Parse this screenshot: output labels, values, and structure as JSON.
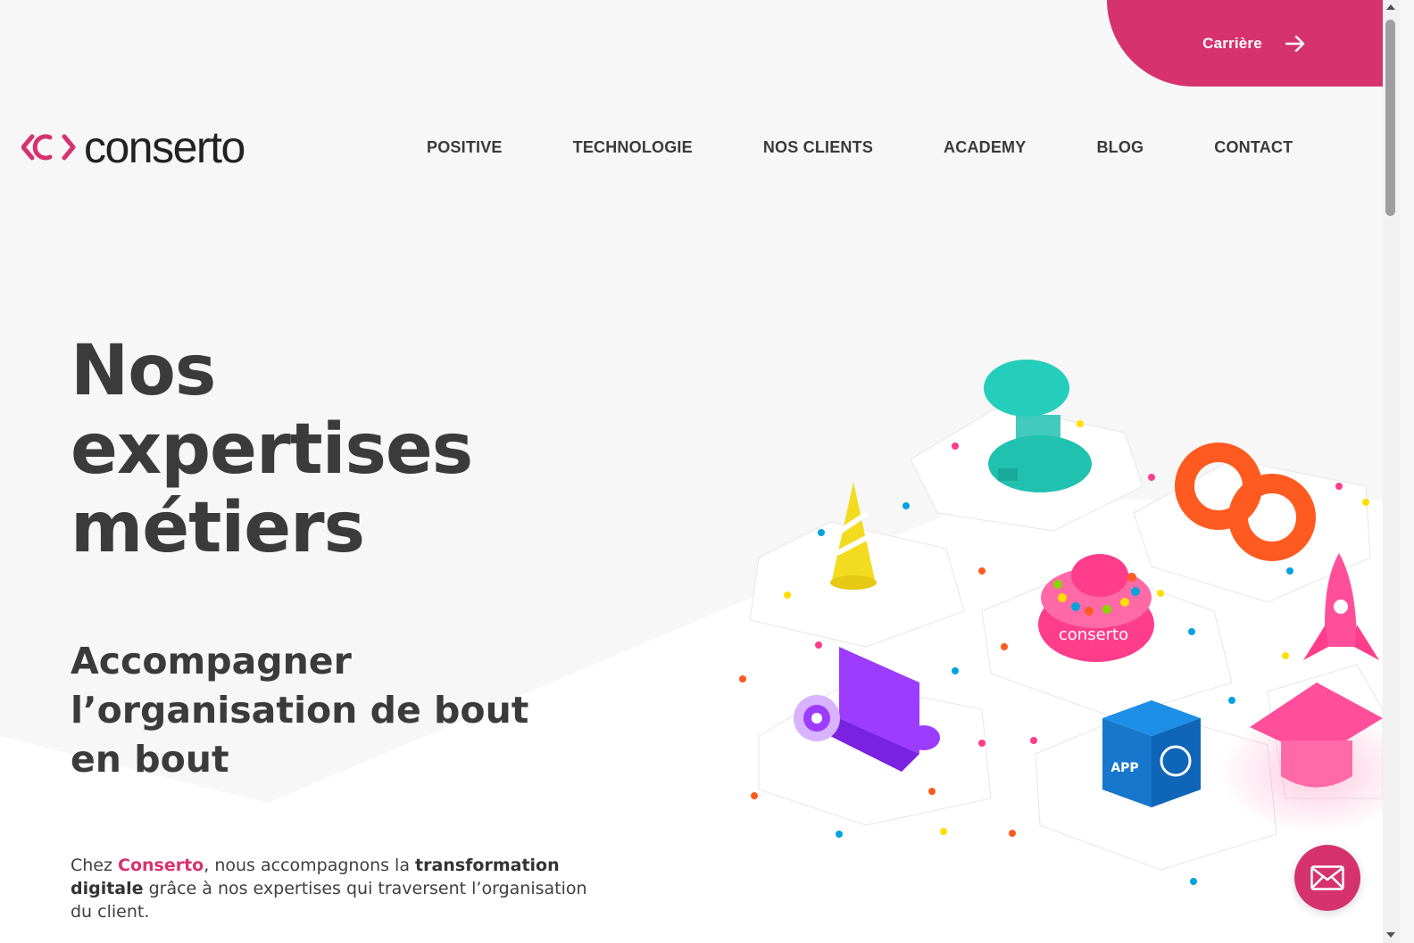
{
  "header": {
    "career_label": "Carrière",
    "logo_text": "conserto",
    "nav": [
      "POSITIVE",
      "TECHNOLOGIE",
      "NOS CLIENTS",
      "ACADEMY",
      "BLOG",
      "CONTACT"
    ]
  },
  "hero": {
    "title_lines": [
      "Nos",
      "expertises",
      "métiers"
    ],
    "subtitle_lines": [
      "Accompagner",
      "l’organisation de bout",
      "en bout"
    ],
    "intro": {
      "p1": "Chez ",
      "brand": "Conserto",
      "p2": ", nous accompagnons la ",
      "bold": "transformation digitale",
      "p3": " grâce à nos expertises qui traversent l’organisation du client."
    }
  },
  "illustration": {
    "badge_text": "conserto",
    "cube_label": "APP"
  },
  "colors": {
    "accent": "#d6326e",
    "text": "#3b3b3b",
    "background": "#f7f7f7"
  },
  "icons": {
    "career_arrow": "arrow-right-icon",
    "contact": "mail-icon"
  }
}
